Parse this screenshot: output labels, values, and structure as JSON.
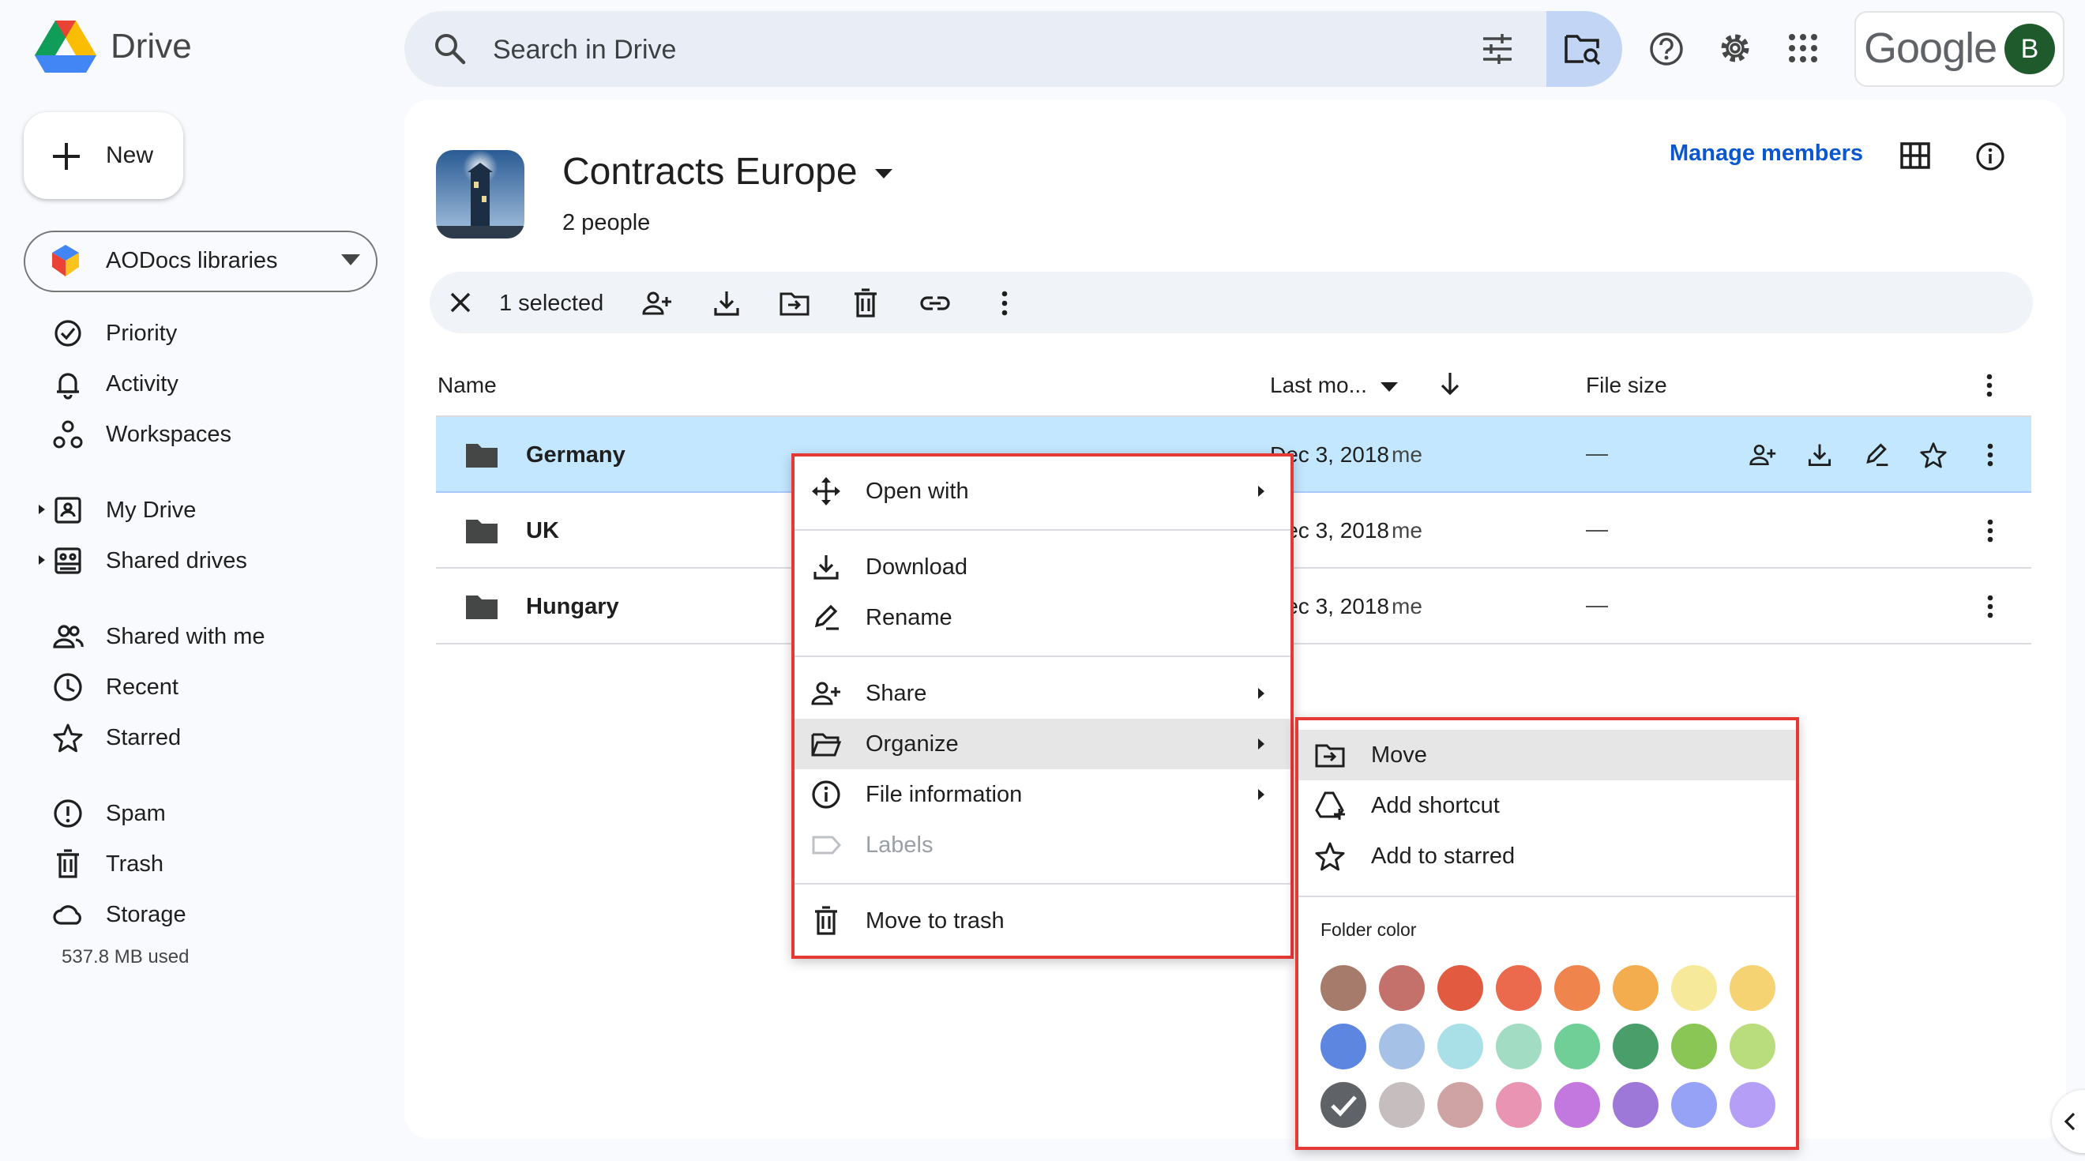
{
  "app": {
    "brand": "Drive"
  },
  "search": {
    "placeholder": "Search in Drive"
  },
  "account": {
    "brand_word": "Google",
    "avatar_letter": "B"
  },
  "sidebar": {
    "new_label": "New",
    "library_label": "AODocs libraries",
    "items": [
      {
        "label": "Priority",
        "icon": "priority-icon"
      },
      {
        "label": "Activity",
        "icon": "bell-icon"
      },
      {
        "label": "Workspaces",
        "icon": "workspaces-icon"
      },
      {
        "label": "My Drive",
        "icon": "my-drive-icon"
      },
      {
        "label": "Shared drives",
        "icon": "shared-drives-icon"
      },
      {
        "label": "Shared with me",
        "icon": "people-icon"
      },
      {
        "label": "Recent",
        "icon": "clock-icon"
      },
      {
        "label": "Starred",
        "icon": "star-icon"
      },
      {
        "label": "Spam",
        "icon": "spam-icon"
      },
      {
        "label": "Trash",
        "icon": "trash-icon"
      },
      {
        "label": "Storage",
        "icon": "cloud-icon"
      }
    ],
    "storage_used": "537.8 MB used"
  },
  "drive": {
    "title": "Contracts Europe",
    "people": "2 people",
    "manage_members": "Manage members"
  },
  "selection": {
    "text": "1 selected"
  },
  "table": {
    "headers": {
      "name": "Name",
      "modified": "Last mo...",
      "size": "File size"
    },
    "rows": [
      {
        "name": "Germany",
        "date": "Dec 3, 2018",
        "owner": "me",
        "size": "—",
        "selected": true
      },
      {
        "name": "UK",
        "date": "Dec 3, 2018",
        "owner": "me",
        "size": "—",
        "selected": false
      },
      {
        "name": "Hungary",
        "date": "Dec 3, 2018",
        "owner": "me",
        "size": "—",
        "selected": false
      }
    ]
  },
  "context_menu": {
    "items": [
      {
        "label": "Open with",
        "icon": "open-with-icon",
        "submenu": true
      },
      {
        "label": "Download",
        "icon": "download-icon",
        "submenu": false
      },
      {
        "label": "Rename",
        "icon": "rename-icon",
        "submenu": false
      },
      {
        "label": "Share",
        "icon": "share-icon",
        "submenu": true
      },
      {
        "label": "Organize",
        "icon": "organize-icon",
        "submenu": true,
        "highlighted": true
      },
      {
        "label": "File information",
        "icon": "info-icon",
        "submenu": true
      },
      {
        "label": "Labels",
        "icon": "label-icon",
        "submenu": false,
        "disabled": true
      },
      {
        "label": "Move to trash",
        "icon": "trash-icon",
        "submenu": false
      }
    ]
  },
  "organize_menu": {
    "items": [
      {
        "label": "Move",
        "icon": "move-icon",
        "highlighted": true
      },
      {
        "label": "Add shortcut",
        "icon": "add-shortcut-icon"
      },
      {
        "label": "Add to starred",
        "icon": "star-icon"
      }
    ],
    "folder_color_label": "Folder color",
    "colors": [
      "#a67b6b",
      "#c4716c",
      "#e25a40",
      "#eb6a4e",
      "#ef844d",
      "#f3ad4f",
      "#f7e99a",
      "#f6d372",
      "#5c86e0",
      "#a5c2e6",
      "#a9dfe6",
      "#a2dcc2",
      "#6fcf97",
      "#4a9e6a",
      "#8ac656",
      "#b9dc7c",
      "#5f6368",
      "#c6bebe",
      "#cfa3a4",
      "#ea94b4",
      "#c378e0",
      "#9d78d8",
      "#95a2f6",
      "#b59ff6"
    ],
    "selected_color_index": 16
  }
}
